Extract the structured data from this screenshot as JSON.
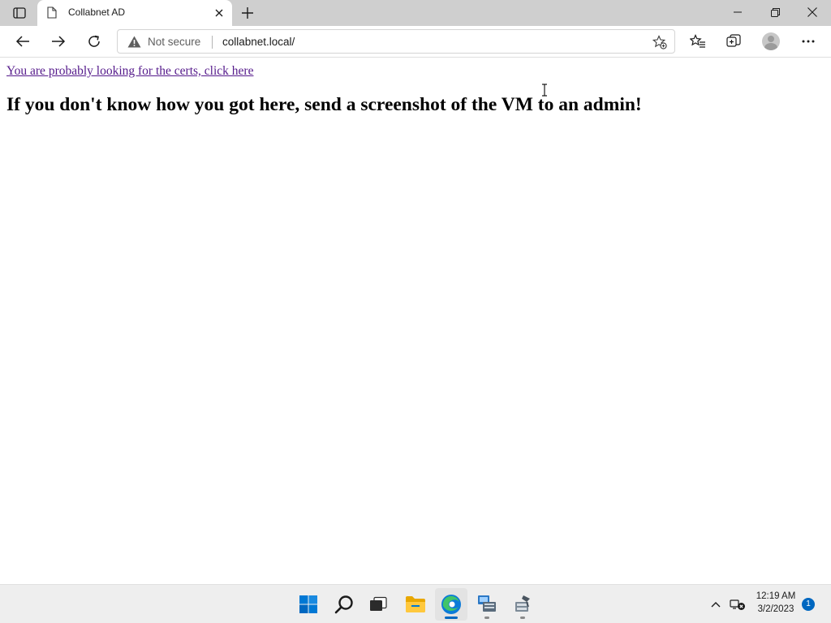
{
  "browser": {
    "tab": {
      "title": "Collabnet AD"
    },
    "address": {
      "security_label": "Not secure",
      "url": "collabnet.local/"
    }
  },
  "page": {
    "link_text": "You are probably looking for the certs, click here",
    "heading": "If you don't know how you got here, send a screenshot of the VM to an admin!"
  },
  "taskbar": {
    "clock": {
      "time": "12:19 AM",
      "date": "3/2/2023"
    },
    "notification_count": "1"
  },
  "colors": {
    "link_visited": "#551a8b",
    "accent": "#0067c0",
    "tabstrip_bg": "#cfcfcf",
    "taskbar_bg": "#eeeeee"
  }
}
